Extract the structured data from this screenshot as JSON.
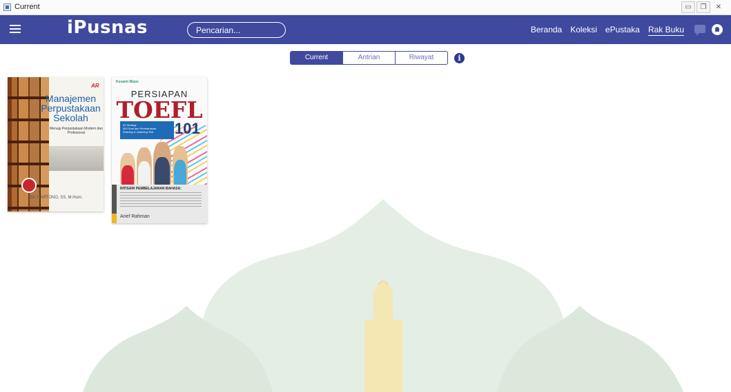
{
  "window": {
    "title": "Current",
    "controls": [
      "minimize",
      "restore",
      "close"
    ]
  },
  "header": {
    "logo": "iPusnas",
    "search_placeholder": "Pencarian...",
    "nav": [
      {
        "label": "Beranda",
        "active": false
      },
      {
        "label": "Koleksi",
        "active": false
      },
      {
        "label": "ePustaka",
        "active": false
      },
      {
        "label": "Rak Buku",
        "active": true
      }
    ],
    "icons": [
      "menu-icon",
      "chat-icon",
      "user-icon"
    ]
  },
  "tabs": [
    {
      "label": "Current",
      "active": true
    },
    {
      "label": "Antrian",
      "active": false
    },
    {
      "label": "Riwayat",
      "active": false
    }
  ],
  "books": [
    {
      "title_line1": "Manajemen",
      "title_line2": "Perpustakaan",
      "title_line3": "Sekolah",
      "subtitle": "Menuju Perpustakaan Modern dan Profesional",
      "author": "Drs. HARTONO, SS, M.Hum.",
      "publisher_logo": "AR"
    },
    {
      "brand": "Kesaint Blanc",
      "title_line1": "PERSIAPAN",
      "title_line2": "TOEFL",
      "number": "101",
      "blue_box": [
        "92 Strategi",
        "500 Soal dan Pembahasan",
        "Reading & Listening Test"
      ],
      "info_title": "INTISARI PEMBELAJARAN BAHASA:",
      "author": "Arief Rahman"
    }
  ],
  "colors": {
    "primary": "#3f4a9e",
    "watermark_green": "#d3e4d3",
    "watermark_gold": "#f4e4a8"
  }
}
